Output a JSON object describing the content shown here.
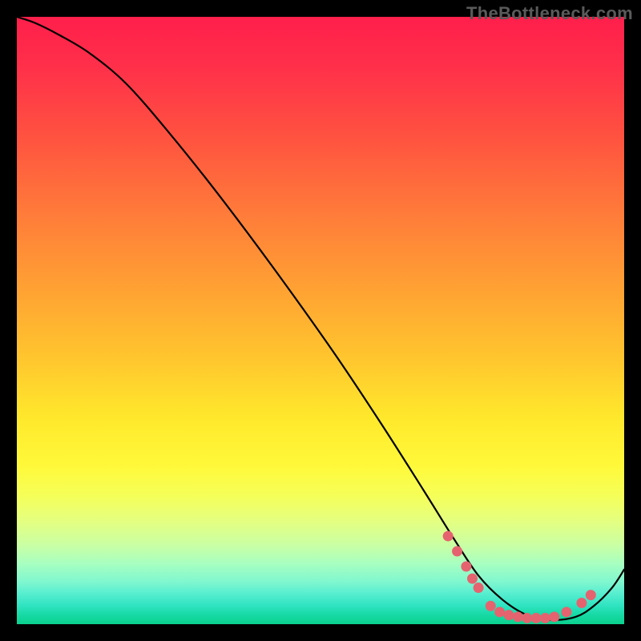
{
  "watermark": "TheBottleneck.com",
  "chart_data": {
    "type": "line",
    "title": "",
    "xlabel": "",
    "ylabel": "",
    "xlim": [
      0,
      100
    ],
    "ylim": [
      0,
      100
    ],
    "series": [
      {
        "name": "curve",
        "x": [
          0,
          3,
          7,
          12,
          18,
          25,
          33,
          42,
          52,
          60,
          67,
          72,
          76,
          80,
          84,
          88,
          92,
          95,
          98,
          100
        ],
        "y": [
          100,
          99,
          97,
          94,
          89,
          81,
          71,
          59,
          45,
          33,
          22,
          14,
          8,
          4,
          1.5,
          0.7,
          1.2,
          3,
          6,
          9
        ]
      }
    ],
    "markers": {
      "name": "highlight-dots",
      "color": "#e5636f",
      "points": [
        {
          "x": 71,
          "y": 14.5
        },
        {
          "x": 72.5,
          "y": 12.0
        },
        {
          "x": 74,
          "y": 9.5
        },
        {
          "x": 75,
          "y": 7.5
        },
        {
          "x": 76,
          "y": 6.0
        },
        {
          "x": 78,
          "y": 3.0
        },
        {
          "x": 79.5,
          "y": 2.0
        },
        {
          "x": 81,
          "y": 1.5
        },
        {
          "x": 82.5,
          "y": 1.2
        },
        {
          "x": 84,
          "y": 1.0
        },
        {
          "x": 85.5,
          "y": 1.0
        },
        {
          "x": 87,
          "y": 1.0
        },
        {
          "x": 88.5,
          "y": 1.2
        },
        {
          "x": 90.5,
          "y": 2.0
        },
        {
          "x": 93,
          "y": 3.5
        },
        {
          "x": 94.5,
          "y": 4.8
        }
      ]
    },
    "background_gradient": {
      "direction": "vertical",
      "stops": [
        {
          "pos": 0.0,
          "color": "#ff1f4b"
        },
        {
          "pos": 0.45,
          "color": "#ffa233"
        },
        {
          "pos": 0.74,
          "color": "#fff93a"
        },
        {
          "pos": 0.9,
          "color": "#a8ffc0"
        },
        {
          "pos": 1.0,
          "color": "#0bd18e"
        }
      ]
    }
  }
}
